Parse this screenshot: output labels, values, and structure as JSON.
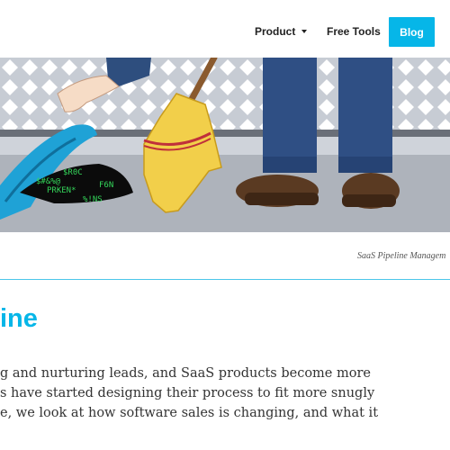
{
  "nav": {
    "items": [
      {
        "label": "Product"
      },
      {
        "label": "Free Tools"
      }
    ],
    "blog_label": "Blog",
    "colors": {
      "accent": "#06b6e8"
    }
  },
  "hero": {
    "caption": "SaaS Pipeline Managem"
  },
  "article": {
    "title": "ine",
    "lines": [
      "g and nurturing leads, and SaaS products become more",
      "s have started designing their process to fit more snugly",
      "e, we look at how software sales is changing, and what it"
    ]
  }
}
